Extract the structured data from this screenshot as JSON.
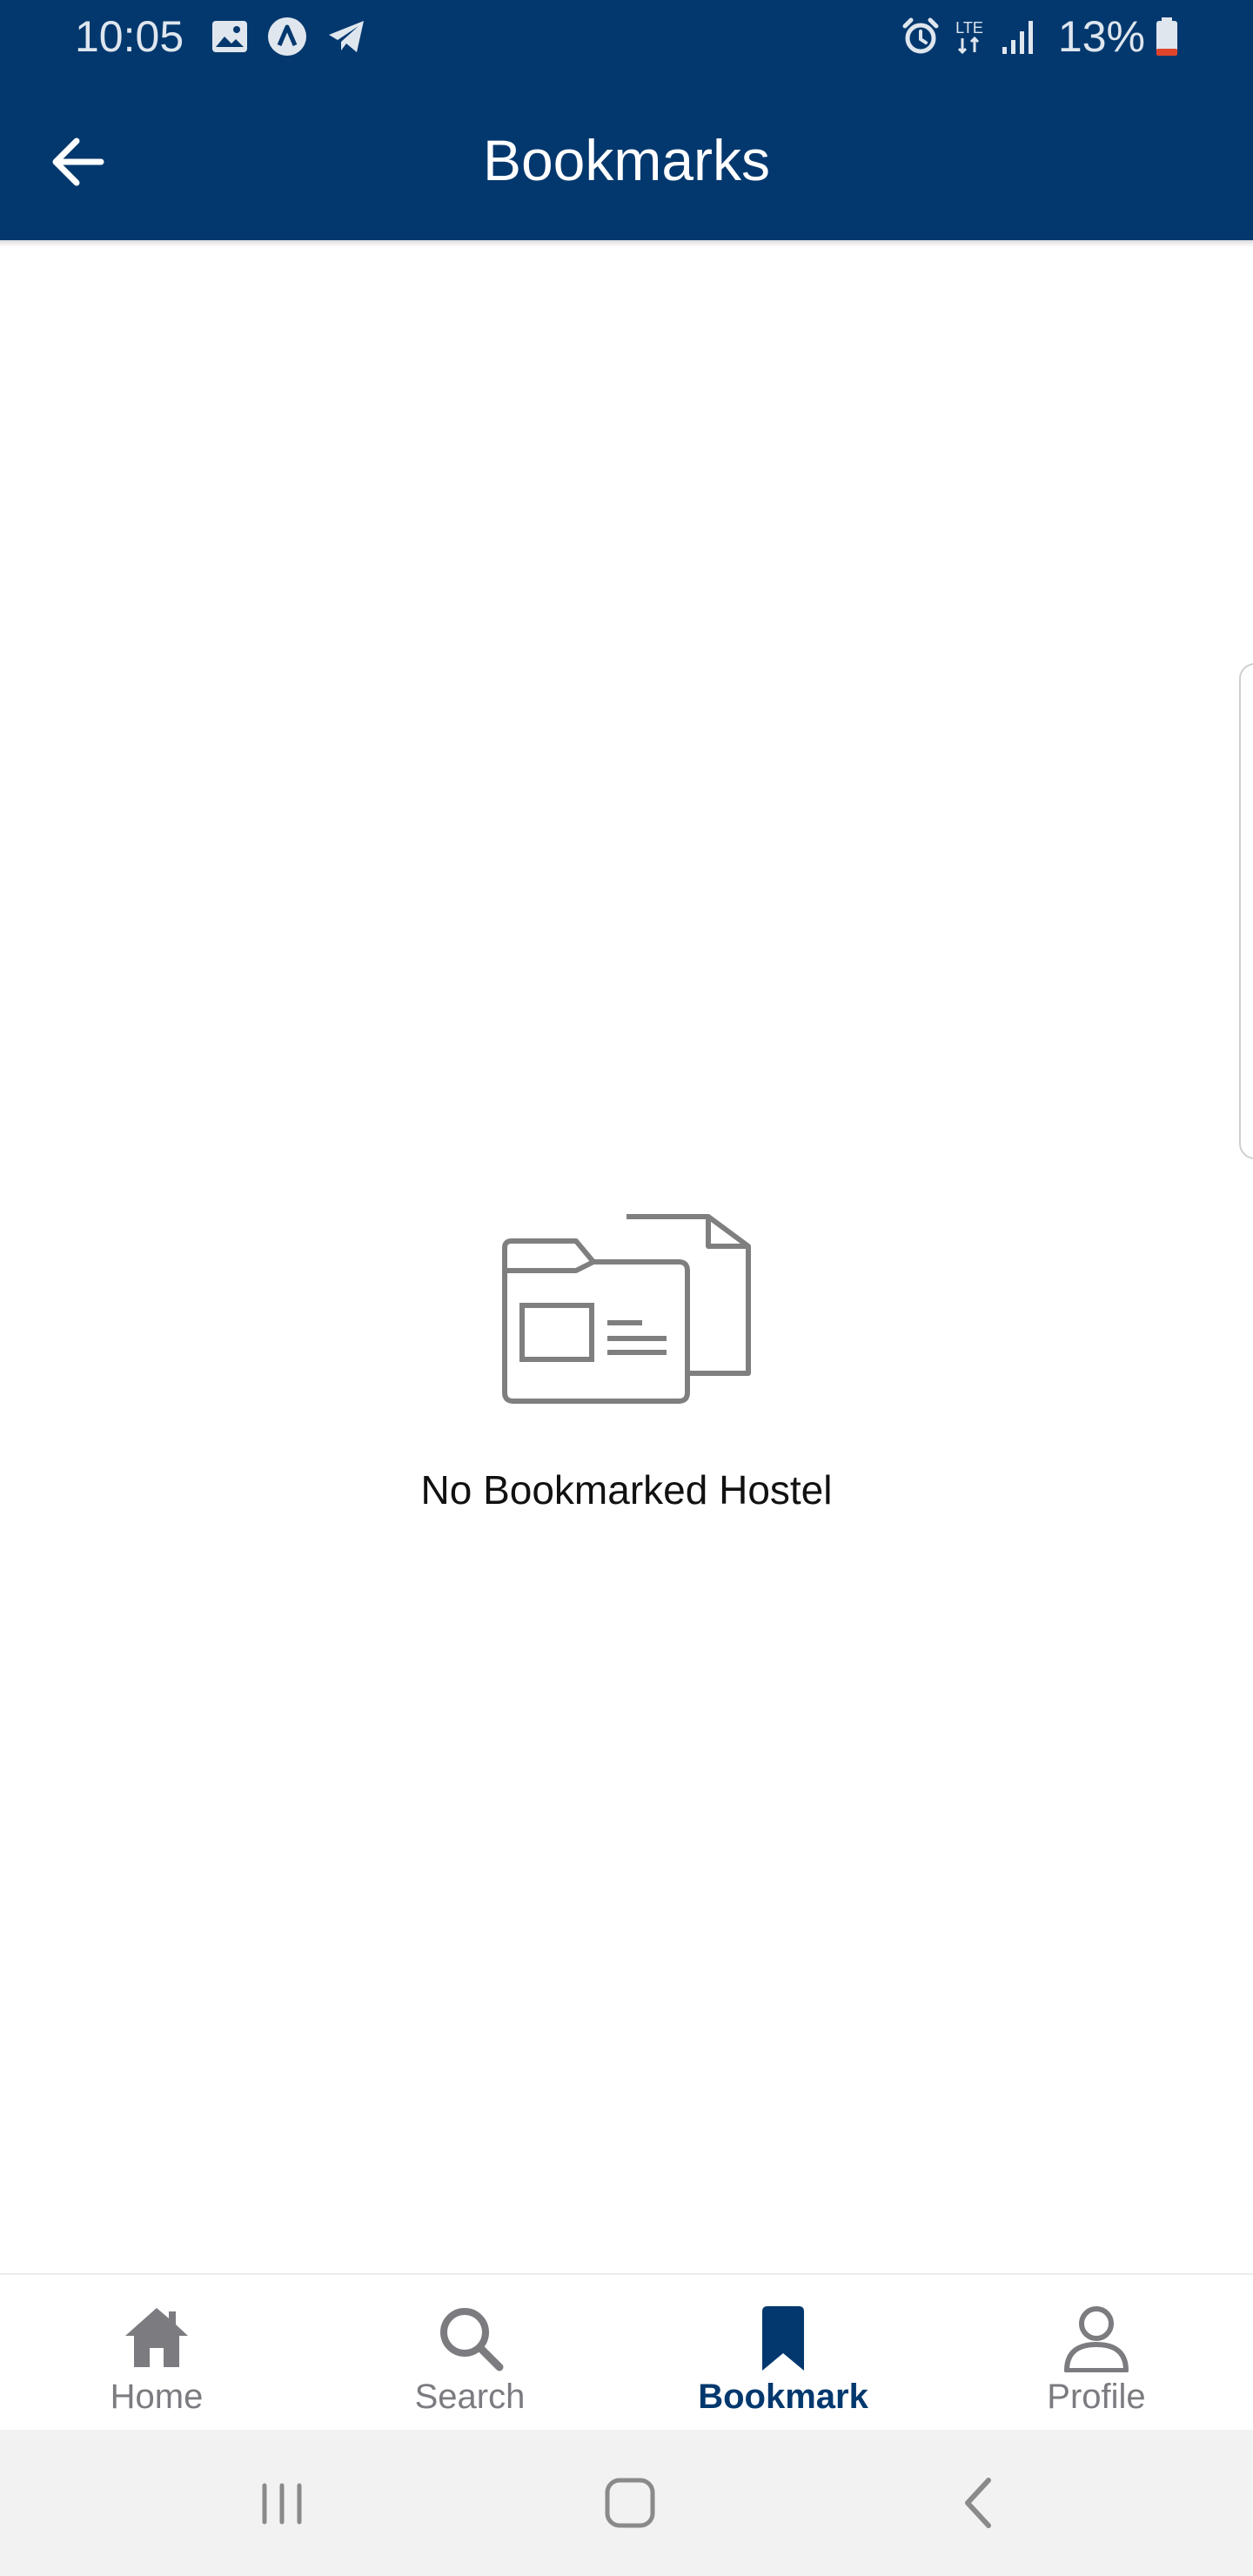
{
  "status_bar": {
    "time": "10:05",
    "battery_text": "13%",
    "icons": [
      "gallery-icon",
      "app-notification-icon",
      "telegram-icon",
      "alarm-icon",
      "lte-icon",
      "signal-icon",
      "battery-icon"
    ]
  },
  "app_bar": {
    "title": "Bookmarks",
    "back_icon": "arrow-left-icon"
  },
  "empty_state": {
    "icon": "folder-document-icon",
    "message": "No Bookmarked Hostel"
  },
  "bottom_nav": {
    "items": [
      {
        "label": "Home",
        "icon": "home-icon",
        "active": false
      },
      {
        "label": "Search",
        "icon": "search-icon",
        "active": false
      },
      {
        "label": "Bookmark",
        "icon": "bookmark-icon",
        "active": true
      },
      {
        "label": "Profile",
        "icon": "profile-icon",
        "active": false
      }
    ]
  },
  "colors": {
    "primary": "#03386e",
    "inactive": "#7b7b80",
    "background": "#ffffff",
    "system_nav": "#f2f2f2"
  }
}
